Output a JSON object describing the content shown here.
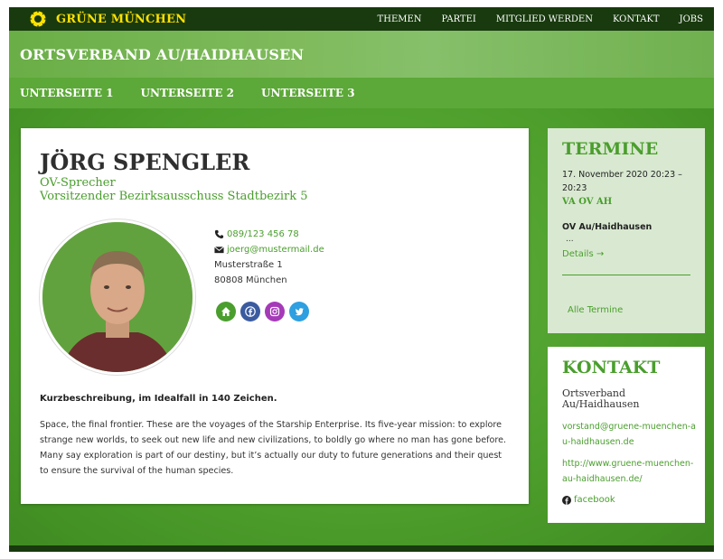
{
  "brand": {
    "name": "GRÜNE MÜNCHEN",
    "logo_icon": "sunflower-icon"
  },
  "topnav": [
    "THEMEN",
    "PARTEI",
    "MITGLIED WERDEN",
    "KONTAKT",
    "JOBS"
  ],
  "banner": {
    "title": "ORTSVERBAND AU/HAIDHAUSEN"
  },
  "subnav": [
    "UNTERSEITE 1",
    "UNTERSEITE 2",
    "UNTERSEITE 3"
  ],
  "person": {
    "name": "JÖRG SPENGLER",
    "role1": "OV-Sprecher",
    "role2": "Vorsitzender Bezirksausschuss Stadtbezirk 5",
    "phone": "089/123 456 78",
    "email": "joerg@mustermail.de",
    "street": "Musterstraße 1",
    "city": "80808 München",
    "socials": [
      {
        "icon": "home-icon",
        "color": "#4a9e2d"
      },
      {
        "icon": "facebook-icon",
        "color": "#3b5ba0"
      },
      {
        "icon": "instagram-icon",
        "color": "#a53ab8"
      },
      {
        "icon": "twitter-icon",
        "color": "#2e9fe0"
      }
    ],
    "short_title": "Kurzbeschreibung, im Idealfall in 140 Zeichen.",
    "description": "Space, the final frontier. These are the voyages of the Starship Enterprise. Its five-year mission: to explore strange new worlds, to seek out new life and new civilizations, to boldly go where no man has gone before. Many say exploration is part of our destiny, but it’s actually our duty to future generations and their quest to ensure the survival of the human species."
  },
  "termine": {
    "heading": "TERMINE",
    "date": "17. November 2020 20:23 – 20:23",
    "event_title": "VA OV AH",
    "org": "OV Au/Haidhausen",
    "ellipsis": "...",
    "details": "Details →",
    "all": "Alle Termine"
  },
  "kontakt": {
    "heading": "KONTAKT",
    "org": "Ortsverband Au/Haidhausen",
    "email": "vorstand@gruene-muenchen-au-haidhausen.de",
    "web": "http://www.gruene-muenchen-au-haidhausen.de/",
    "facebook": "facebook"
  },
  "colors": {
    "accent": "#4a9e2d",
    "dark": "#183a0e",
    "brand_yellow": "#ffe100"
  }
}
